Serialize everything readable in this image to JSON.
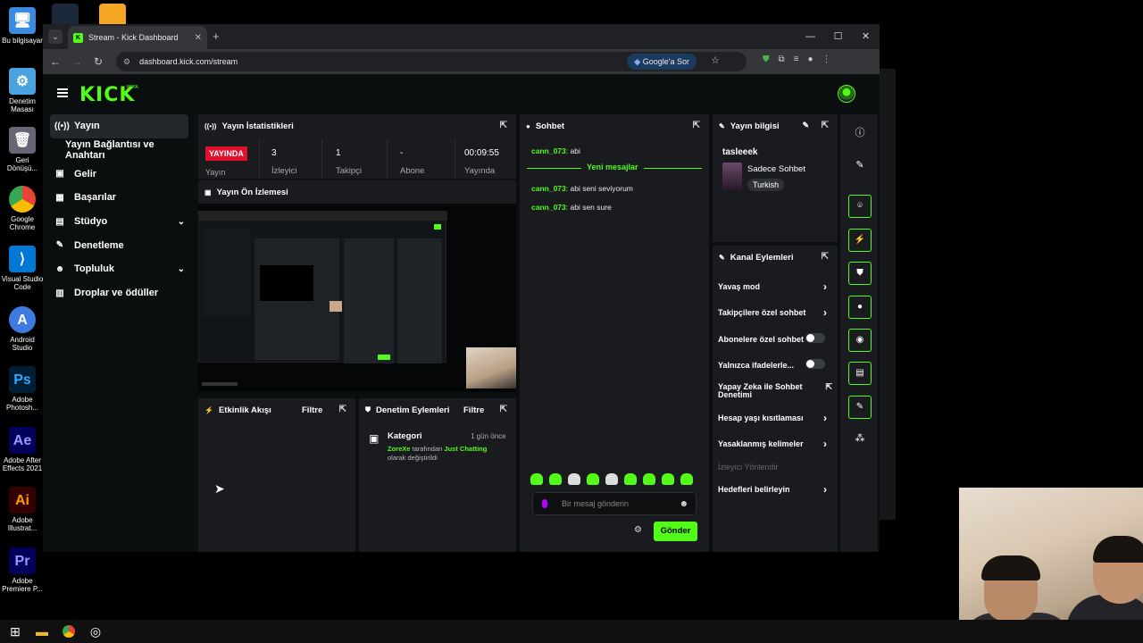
{
  "desktop": {
    "icons": [
      {
        "label": "Bu bilgisayar",
        "icon": "computer-icon"
      },
      {
        "label": "Denetim Masası",
        "icon": "control-panel-icon"
      },
      {
        "label": "Geri Dönüşü...",
        "icon": "recycle-bin-icon"
      },
      {
        "label": "Google Chrome",
        "icon": "chrome-icon"
      },
      {
        "label": "Visual Studio Code",
        "icon": "vscode-icon"
      },
      {
        "label": "Android Studio",
        "icon": "android-studio-icon"
      },
      {
        "label": "Adobe Photosh...",
        "icon": "photoshop-icon",
        "short": "Ps"
      },
      {
        "label": "Adobe After Effects 2021",
        "icon": "after-effects-icon",
        "short": "Ae"
      },
      {
        "label": "Adobe Illustrat...",
        "icon": "illustrator-icon",
        "short": "Ai"
      },
      {
        "label": "Adobe Premiere P...",
        "icon": "premiere-icon",
        "short": "Pr"
      }
    ]
  },
  "browser": {
    "tab_title": "Stream - Kick Dashboard",
    "url": "dashboard.kick.com/stream",
    "google_sor": "Google'a Sor"
  },
  "kick": {
    "logo": "KICK",
    "beta": "BETA",
    "sidebar": [
      {
        "label": "Yayın",
        "icon": "broadcast-icon"
      },
      {
        "label": "Yayın Bağlantısı ve Anahtarı",
        "icon": ""
      },
      {
        "label": "Gelir",
        "icon": "money-icon"
      },
      {
        "label": "Başarılar",
        "icon": "trophy-icon"
      },
      {
        "label": "Stüdyo",
        "icon": "studio-icon"
      },
      {
        "label": "Denetleme",
        "icon": "moderation-icon"
      },
      {
        "label": "Topluluk",
        "icon": "community-icon"
      },
      {
        "label": "Droplar ve ödüller",
        "icon": "drops-icon"
      }
    ],
    "stats": {
      "title": "Yayın İstatistikleri",
      "status": "YAYINDA",
      "viewers_value": "3",
      "viewers_label": "İzleyici",
      "followers_value": "1",
      "followers_label": "Takipçi",
      "subs_value": "-",
      "subs_label": "Abone",
      "uptime_value": "00:09:55",
      "uptime_label": "Yayında",
      "extra_label": "Yayın"
    },
    "preview": {
      "title": "Yayın Ön İzlemesi"
    },
    "activity": {
      "title": "Etkinlik Akışı",
      "filter": "Filtre"
    },
    "modlog": {
      "title": "Denetim Eylemleri",
      "filter": "Filtre",
      "entry_title": "Kategori",
      "entry_time": "1 gün önce",
      "entry_user": "ZoreXe",
      "entry_mid": "tarafından",
      "entry_cat": "Just Chatting",
      "entry_tail": "olarak değiştirildi"
    },
    "chat": {
      "title": "Sohbet",
      "new_messages": "Yeni mesajlar",
      "messages": [
        {
          "user": "cann_073",
          "text": "abi"
        },
        {
          "user": "cann_073",
          "text": "abi seni seviyorum"
        },
        {
          "user": "cann_073",
          "text": "abi sen sure"
        }
      ],
      "placeholder": "Bir mesaj gönderin",
      "send": "Gönder"
    },
    "info": {
      "title": "Yayın bilgisi",
      "username": "tasleeek",
      "category": "Sadece Sohbet",
      "language": "Turkish"
    },
    "channel_actions": {
      "title": "Kanal Eylemleri",
      "items": [
        {
          "label": "Yavaş mod",
          "type": "arrow"
        },
        {
          "label": "Takipçilere özel sohbet",
          "type": "arrow"
        },
        {
          "label": "Abonelere özel sohbet",
          "type": "toggle",
          "on": false
        },
        {
          "label": "Yalnızca ifadelerle...",
          "type": "toggle",
          "on": false
        },
        {
          "label": "Yapay Zeka ile Sohbet Denetimi",
          "type": "external"
        },
        {
          "label": "Hesap yaşı kısıtlaması",
          "type": "arrow"
        },
        {
          "label": "Yasaklanmış kelimeler",
          "type": "arrow"
        },
        {
          "label": "İzleyici Yönlendir",
          "type": "disabled"
        },
        {
          "label": "Hedefleri belirleyin",
          "type": "arrow"
        }
      ]
    }
  },
  "colors": {
    "accent": "#53fc18",
    "live": "#e30f2e",
    "panel": "#191b1f",
    "bg": "#0b0e0f"
  }
}
